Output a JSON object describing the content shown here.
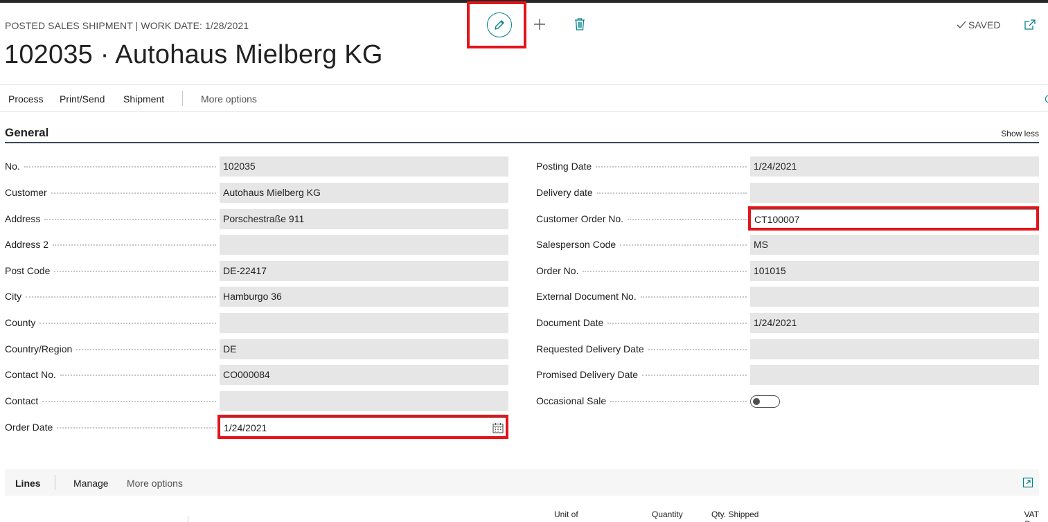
{
  "header": {
    "breadcrumb": "POSTED SALES SHIPMENT | WORK DATE: 1/28/2021",
    "title": "102035 · Autohaus Mielberg KG",
    "saved_label": "SAVED"
  },
  "icons": {
    "edit": "pencil-icon",
    "new": "plus-icon",
    "delete": "trash-icon",
    "saved": "check-icon",
    "popout": "popout-icon",
    "calendar": "calendar-icon",
    "expand": "expand-icon"
  },
  "colors": {
    "accent": "#00818a",
    "highlight": "#e3151a",
    "field_bg": "#e6e6e6"
  },
  "actions": {
    "process": "Process",
    "print_send": "Print/Send",
    "shipment": "Shipment",
    "more_options": "More options"
  },
  "general": {
    "title": "General",
    "show_less": "Show less",
    "left": [
      {
        "label": "No.",
        "value": "102035"
      },
      {
        "label": "Customer",
        "value": "Autohaus Mielberg KG"
      },
      {
        "label": "Address",
        "value": "Porschestraße 911"
      },
      {
        "label": "Address 2",
        "value": ""
      },
      {
        "label": "Post Code",
        "value": "DE-22417"
      },
      {
        "label": "City",
        "value": "Hamburgo 36"
      },
      {
        "label": "County",
        "value": ""
      },
      {
        "label": "Country/Region",
        "value": "DE"
      },
      {
        "label": "Contact No.",
        "value": "CO000084"
      },
      {
        "label": "Contact",
        "value": ""
      },
      {
        "label": "Order Date",
        "value": "1/24/2021"
      }
    ],
    "right": [
      {
        "label": "Posting Date",
        "value": "1/24/2021"
      },
      {
        "label": "Delivery date",
        "value": ""
      },
      {
        "label": "Customer Order No.",
        "value": "CT100007"
      },
      {
        "label": "Salesperson Code",
        "value": "MS"
      },
      {
        "label": "Order No.",
        "value": "101015"
      },
      {
        "label": "External Document No.",
        "value": ""
      },
      {
        "label": "Document Date",
        "value": "1/24/2021"
      },
      {
        "label": "Requested Delivery Date",
        "value": ""
      },
      {
        "label": "Promised Delivery Date",
        "value": ""
      },
      {
        "label": "Occasional Sale",
        "value": ""
      }
    ],
    "occasional_sale_on": false
  },
  "lines": {
    "title": "Lines",
    "manage": "Manage",
    "more_options": "More options",
    "columns": [
      "Unit of",
      "Quantity",
      "Qty. Shipped",
      "VAT Bas"
    ]
  }
}
